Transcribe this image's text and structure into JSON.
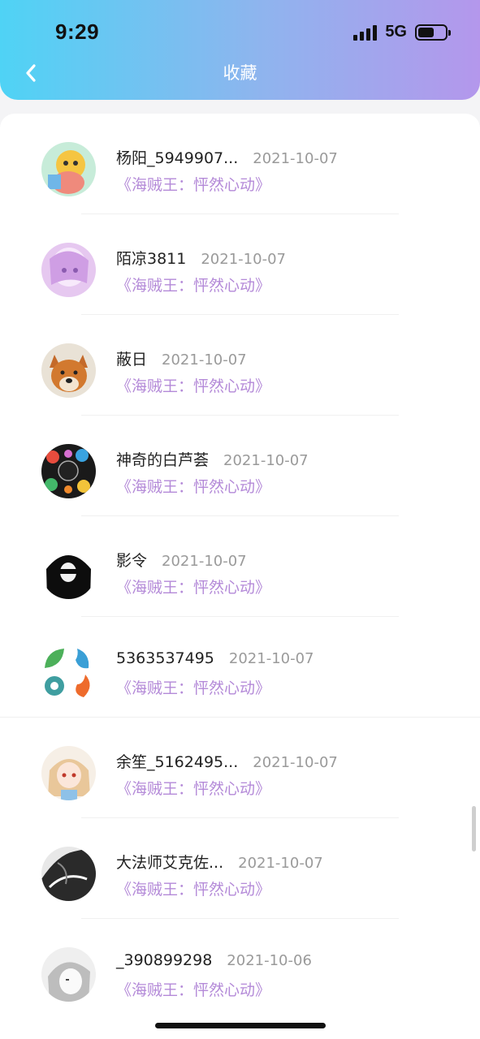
{
  "status_bar": {
    "time": "9:29",
    "network": "5G",
    "battery_level": 0.6
  },
  "header": {
    "title": "收藏",
    "back_icon": "chevron-left-icon"
  },
  "colors": {
    "gradient_start": "#4fd3f5",
    "gradient_end": "#b497ec",
    "work_title": "#b48ad8",
    "date": "#9a9a9a"
  },
  "items": [
    {
      "name": "杨阳_5949907...",
      "date": "2021-10-07",
      "work": "《海贼王：怦然心动》",
      "avatar": "cartoon-bear-avatar"
    },
    {
      "name": "陌凉3811",
      "date": "2021-10-07",
      "work": "《海贼王：怦然心动》",
      "avatar": "anime-girl-avatar"
    },
    {
      "name": "蔽日",
      "date": "2021-10-07",
      "work": "《海贼王：怦然心动》",
      "avatar": "dog-avatar"
    },
    {
      "name": "神奇的白芦荟",
      "date": "2021-10-07",
      "work": "《海贼王：怦然心动》",
      "avatar": "colorful-collage-avatar"
    },
    {
      "name": "影令",
      "date": "2021-10-07",
      "work": "《海贼王：怦然心动》",
      "avatar": "dark-anime-avatar"
    },
    {
      "name": "5363537495",
      "date": "2021-10-07",
      "work": "《海贼王：怦然心动》",
      "avatar": "elements-icons-avatar"
    },
    {
      "name": "余笙_5162495...",
      "date": "2021-10-07",
      "work": "《海贼王：怦然心动》",
      "avatar": "anime-catgirl-avatar"
    },
    {
      "name": "大法师艾克佐...",
      "date": "2021-10-07",
      "work": "《海贼王：怦然心动》",
      "avatar": "manga-sketch-avatar"
    },
    {
      "name": "_390899298",
      "date": "2021-10-06",
      "work": "《海贼王：怦然心动》",
      "avatar": "anime-sketch-avatar"
    }
  ]
}
